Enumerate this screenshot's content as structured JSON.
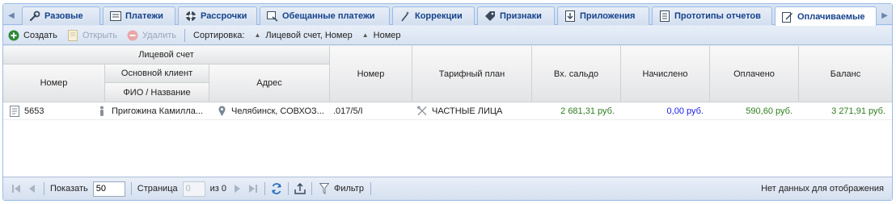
{
  "tabs": [
    {
      "label": "Разовые",
      "icon": "wrench-icon"
    },
    {
      "label": "Платежи",
      "icon": "list-icon"
    },
    {
      "label": "Рассрочки",
      "icon": "lifebuoy-icon"
    },
    {
      "label": "Обещанные платежи",
      "icon": "promise-icon"
    },
    {
      "label": "Коррекции",
      "icon": "magic-wand-icon"
    },
    {
      "label": "Признаки",
      "icon": "tag-icon"
    },
    {
      "label": "Приложения",
      "icon": "download-icon"
    },
    {
      "label": "Прототипы отчетов",
      "icon": "report-icon"
    },
    {
      "label": "Оплачиваемые",
      "icon": "edit-document-icon"
    }
  ],
  "toolbar": {
    "create_label": "Создать",
    "open_label": "Открыть",
    "delete_label": "Удалить",
    "sort_label": "Сортировка:",
    "sort_key_1": "Лицевой счет, Номер",
    "sort_key_2": "Номер"
  },
  "grid": {
    "headers": {
      "account": "Лицевой счет",
      "number": "Номер",
      "main_client": "Основной клиент",
      "fio": "ФИО / Название",
      "address": "Адрес",
      "number2": "Номер",
      "tariff": "Тарифный план",
      "opening_balance": "Вх. сальдо",
      "charged": "Начислено",
      "paid": "Оплачено",
      "balance": "Баланс"
    },
    "rows": [
      {
        "number": "5653",
        "fio": "Пригожина Камилла...",
        "address": "Челябинск, СОВХОЗ...",
        "number2": ".017/5/I",
        "tariff": "ЧАСТНЫЕ ЛИЦА",
        "opening_balance": "2 681,31 руб.",
        "charged": "0,00 руб.",
        "paid": "590,60 руб.",
        "balance": "3 271,91 руб."
      }
    ]
  },
  "pager": {
    "show_label": "Показать",
    "page_size": "50",
    "page_label": "Страница",
    "page_value": "0",
    "of_label": "из 0",
    "filter_label": "Фильтр",
    "status": "Нет данных для отображения"
  },
  "colors": {
    "green_amount": "#2e7d1e",
    "blue_amount": "#1a1ae6",
    "tab_text": "#15428b"
  }
}
